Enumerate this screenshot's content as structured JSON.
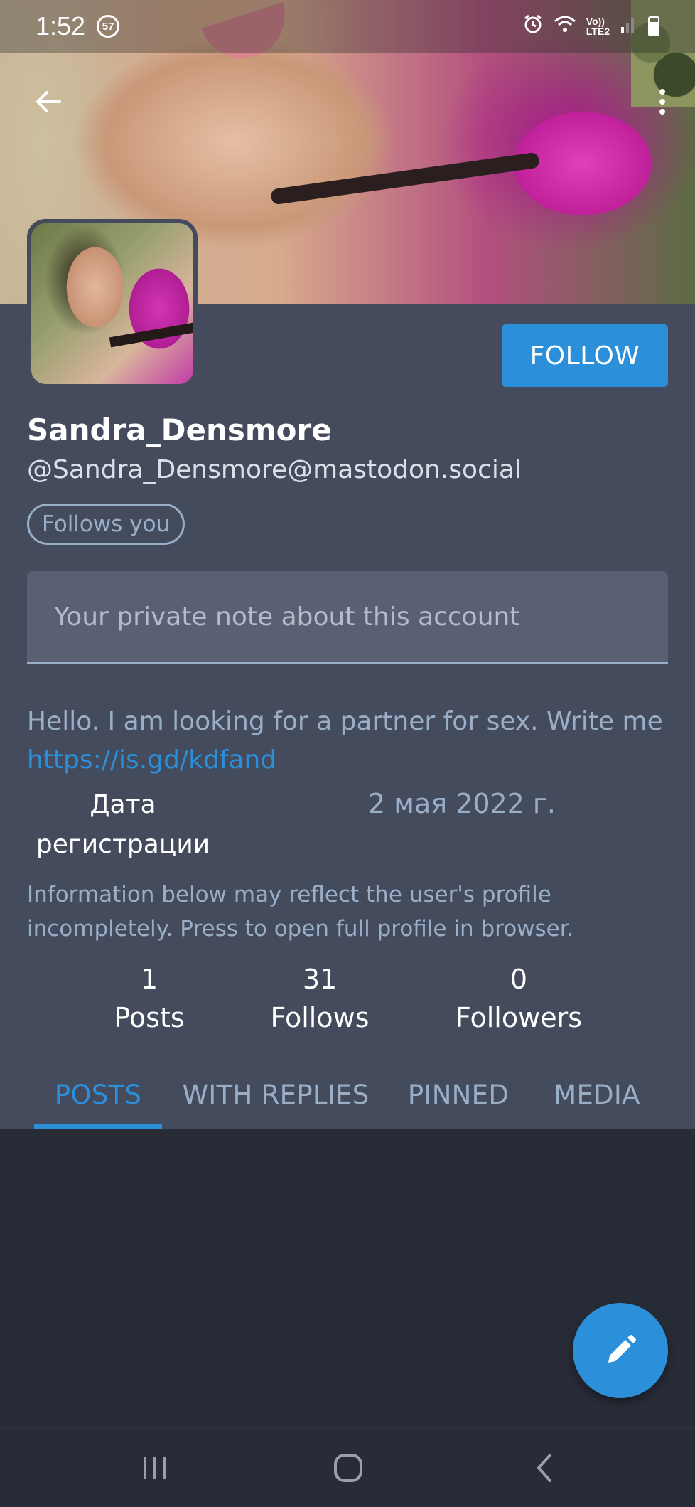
{
  "status_bar": {
    "time": "1:52",
    "notification_count": "57",
    "network_label_top": "Vo))",
    "network_label_bottom": "LTE2"
  },
  "header": {
    "back_icon": "arrow-left-icon",
    "menu_icon": "more-vertical-icon"
  },
  "profile": {
    "display_name": "Sandra_Densmore",
    "handle": "@Sandra_Densmore@mastodon.social",
    "follows_you_label": "Follows you",
    "follow_button_label": "FOLLOW",
    "note_placeholder": "Your private note about this account",
    "bio_text": "Hello. I am looking for a partner for sex. Write me",
    "bio_link": "https://is.gd/kdfand",
    "fields": [
      {
        "name": "Дата регистрации",
        "value": "2 мая 2022 г."
      }
    ],
    "info_note": "Information below may reflect the user's profile incompletely. Press to open full profile in browser."
  },
  "stats": [
    {
      "count": "1",
      "label": "Posts"
    },
    {
      "count": "31",
      "label": "Follows"
    },
    {
      "count": "0",
      "label": "Followers"
    }
  ],
  "tabs": [
    {
      "label": "POSTS",
      "active": true
    },
    {
      "label": "WITH REPLIES",
      "active": false
    },
    {
      "label": "PINNED",
      "active": false
    },
    {
      "label": "MEDIA",
      "active": false
    }
  ],
  "fab_icon": "pencil-icon",
  "nav": {
    "recents_icon": "recents-icon",
    "home_icon": "home-icon",
    "back_icon": "back-chevron-icon"
  },
  "colors": {
    "accent": "#2b90d9",
    "profile_bg": "#444b5d",
    "page_bg": "#282c37",
    "secondary_text": "#9baec8"
  }
}
